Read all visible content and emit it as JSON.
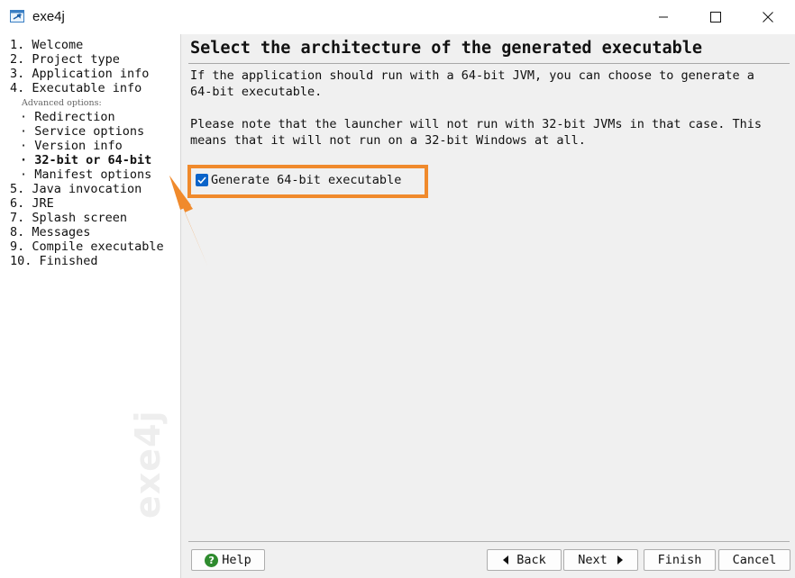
{
  "window": {
    "title": "exe4j",
    "minimize_icon": "minimize-icon",
    "maximize_icon": "maximize-icon",
    "close_icon": "close-icon"
  },
  "sidebar": {
    "steps": [
      "1. Welcome",
      "2. Project type",
      "3. Application info",
      "4. Executable info",
      "5. Java invocation",
      "6. JRE",
      "7. Splash screen",
      "8. Messages",
      "9. Compile executable",
      "10. Finished"
    ],
    "advanced_label": "Advanced options:",
    "substeps": [
      "· Redirection",
      "· Service options",
      "· Version info",
      "· 32-bit or 64-bit",
      "· Manifest options"
    ],
    "current_substep": "· 32-bit or 64-bit",
    "watermark": "exe4j"
  },
  "main": {
    "heading": "Select the architecture of the generated executable",
    "paragraph1": [
      "If the application should run with a 64-bit JVM, you can choose to generate a",
      "64-bit executable."
    ],
    "paragraph2": [
      "Please note that the launcher will not run with 32-bit JVMs in that case. This",
      "means that it will not run on a 32-bit Windows at all."
    ],
    "checkbox_label": "Generate 64-bit executable",
    "checkbox_checked": true
  },
  "buttons": {
    "help": "Help",
    "back": "Back",
    "next": "Next",
    "finish": "Finish",
    "cancel": "Cancel"
  },
  "colors": {
    "annotation": "#f08a2c",
    "checkbox": "#0a63c9",
    "help_icon": "#2e8b2e"
  }
}
